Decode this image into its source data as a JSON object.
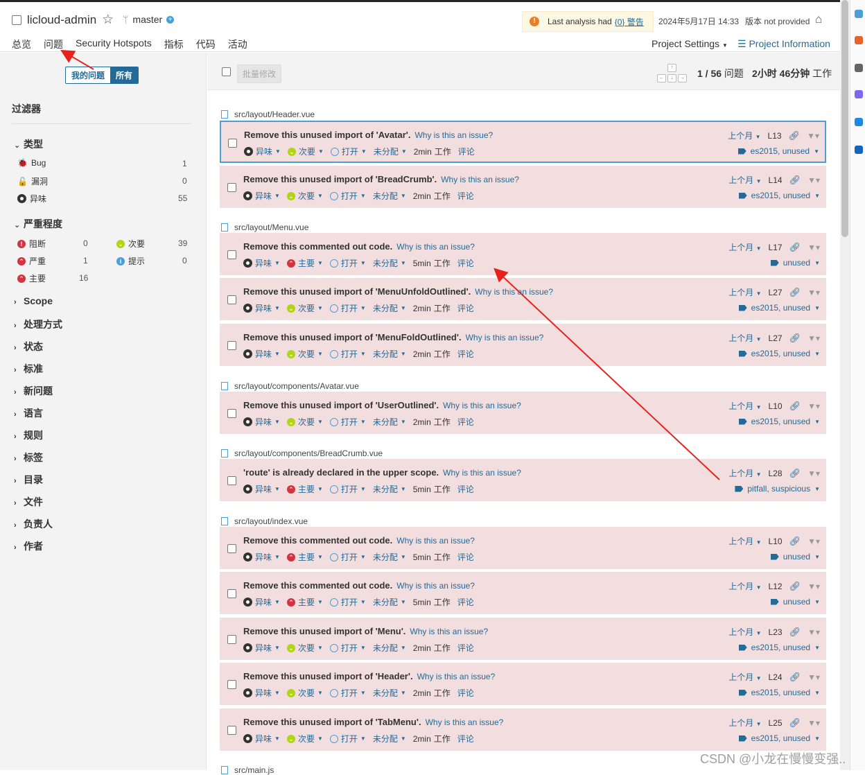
{
  "header": {
    "project_name": "licloud-admin",
    "branch": "master",
    "warning_prefix": "Last analysis had",
    "warning_link": "{0} 警告",
    "analysis_date": "2024年5月17日 14:33",
    "version": "版本 not provided",
    "nav": [
      "总览",
      "问题",
      "Security Hotspots",
      "指标",
      "代码",
      "活动"
    ],
    "project_settings": "Project Settings",
    "project_info": "Project Information"
  },
  "sidebar": {
    "my_issues": "我的问题",
    "all": "所有",
    "filter_title": "过滤器",
    "type_facet": "类型",
    "types": [
      {
        "label": "Bug",
        "count": "1"
      },
      {
        "label": "漏洞",
        "count": "0"
      },
      {
        "label": "异味",
        "count": "55"
      }
    ],
    "severity_facet": "严重程度",
    "severities": [
      {
        "label": "阻断",
        "count": "0"
      },
      {
        "label": "次要",
        "count": "39"
      },
      {
        "label": "严重",
        "count": "1"
      },
      {
        "label": "提示",
        "count": "0"
      },
      {
        "label": "主要",
        "count": "16"
      }
    ],
    "facets": [
      "Scope",
      "处理方式",
      "状态",
      "标准",
      "新问题",
      "语言",
      "规则",
      "标签",
      "目录",
      "文件",
      "负责人",
      "作者"
    ]
  },
  "toolbar": {
    "bulk_change": "批量修改",
    "page_current": "1 / 56",
    "page_suffix": "问题",
    "effort_value": "2小时 46分钟",
    "effort_suffix": "工作"
  },
  "files": [
    "src/layout/Header.vue",
    "src/layout/Menu.vue",
    "src/layout/components/Avatar.vue",
    "src/layout/components/BreadCrumb.vue",
    "src/layout/index.vue",
    "src/main.js"
  ],
  "why": "Why is this an issue?",
  "common": {
    "type": "异味",
    "status": "打开",
    "assignee": "未分配",
    "work": "工作",
    "comment": "评论",
    "date": "上个月"
  },
  "issues": [
    {
      "msg": "Remove this unused import of 'Avatar'.",
      "sev": "次要",
      "effort": "2min",
      "line": "L13",
      "tags": "es2015, unused"
    },
    {
      "msg": "Remove this unused import of 'BreadCrumb'.",
      "sev": "次要",
      "effort": "2min",
      "line": "L14",
      "tags": "es2015, unused"
    },
    {
      "msg": "Remove this commented out code.",
      "sev": "主要",
      "effort": "5min",
      "line": "L17",
      "tags": "unused"
    },
    {
      "msg": "Remove this unused import of 'MenuUnfoldOutlined'.",
      "sev": "次要",
      "effort": "2min",
      "line": "L27",
      "tags": "es2015, unused"
    },
    {
      "msg": "Remove this unused import of 'MenuFoldOutlined'.",
      "sev": "次要",
      "effort": "2min",
      "line": "L27",
      "tags": "es2015, unused"
    },
    {
      "msg": "Remove this unused import of 'UserOutlined'.",
      "sev": "次要",
      "effort": "2min",
      "line": "L10",
      "tags": "es2015, unused"
    },
    {
      "msg": "'route' is already declared in the upper scope.",
      "sev": "主要",
      "effort": "5min",
      "line": "L28",
      "tags": "pitfall, suspicious"
    },
    {
      "msg": "Remove this commented out code.",
      "sev": "主要",
      "effort": "5min",
      "line": "L10",
      "tags": "unused"
    },
    {
      "msg": "Remove this commented out code.",
      "sev": "主要",
      "effort": "5min",
      "line": "L12",
      "tags": "unused"
    },
    {
      "msg": "Remove this unused import of 'Menu'.",
      "sev": "次要",
      "effort": "2min",
      "line": "L23",
      "tags": "es2015, unused"
    },
    {
      "msg": "Remove this unused import of 'Header'.",
      "sev": "次要",
      "effort": "2min",
      "line": "L24",
      "tags": "es2015, unused"
    },
    {
      "msg": "Remove this unused import of 'TabMenu'.",
      "sev": "次要",
      "effort": "2min",
      "line": "L25",
      "tags": "es2015, unused"
    }
  ],
  "watermark": "CSDN @小龙在慢慢变强..",
  "colors": {
    "accent": "#236a97",
    "issue_bg": "#f2dede",
    "annotation": "#e8221b"
  }
}
